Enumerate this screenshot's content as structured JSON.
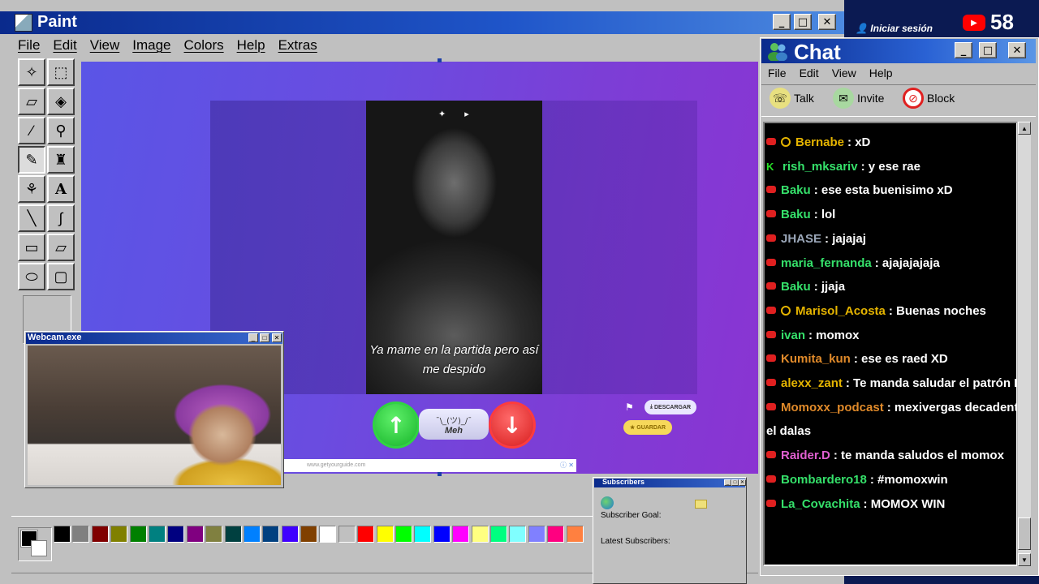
{
  "paint": {
    "title": "Paint",
    "menu": [
      "File",
      "Edit",
      "View",
      "Image",
      "Colors",
      "Help",
      "Extras"
    ],
    "tools": [
      "free-select-icon",
      "rect-select-icon",
      "eraser-icon",
      "fill-icon",
      "picker-icon",
      "magnifier-icon",
      "pencil-icon",
      "brush-icon",
      "airbrush-icon",
      "text-icon",
      "line-icon",
      "curve-icon",
      "rectangle-icon",
      "polygon-icon",
      "ellipse-icon",
      "rounded-rect-icon"
    ],
    "active_tool": "pencil-icon",
    "palette": [
      "#000000",
      "#808080",
      "#800000",
      "#808000",
      "#008000",
      "#008080",
      "#000080",
      "#800080",
      "#808040",
      "#004040",
      "#0080ff",
      "#004080",
      "#4000ff",
      "#804000",
      "#ffffff",
      "#c0c0c0",
      "#ff0000",
      "#ffff00",
      "#00ff00",
      "#00ffff",
      "#0000ff",
      "#ff00ff",
      "#ffff80",
      "#00ff80",
      "#80ffff",
      "#8080ff",
      "#ff0080",
      "#ff8040"
    ]
  },
  "post": {
    "caption_line1": "Ya mame en la partida pero así",
    "caption_line2": "me despido",
    "meh_face": "¯\\_(ツ)_/¯",
    "meh_label": "Meh",
    "descargar_label": "DESCARGAR",
    "guardar_label": "GUARDAR",
    "ad_text": "www.getyourguide.com"
  },
  "topbar": {
    "login_label": "Iniciar sesión",
    "youtube_count": "58"
  },
  "chat": {
    "title": "Chat",
    "menu": [
      "File",
      "Edit",
      "View",
      "Help"
    ],
    "toolbar": [
      {
        "label": "Talk",
        "icon": "talk-icon"
      },
      {
        "label": "Invite",
        "icon": "invite-icon"
      },
      {
        "label": "Block",
        "icon": "block-icon"
      }
    ],
    "messages": [
      {
        "user": "Bernabe",
        "text": ": xD",
        "color": "#e5b400",
        "badge": "yt",
        "mod": true
      },
      {
        "user": "rish_mksariv",
        "text": ": y ese rae",
        "color": "#35e06a",
        "badge": "kick",
        "mod": false
      },
      {
        "user": "Baku",
        "text": ": ese esta buenisimo xD",
        "color": "#35e06a",
        "badge": "yt",
        "mod": false
      },
      {
        "user": "Baku",
        "text": ": lol",
        "color": "#35e06a",
        "badge": "yt",
        "mod": false
      },
      {
        "user": "JHASE",
        "text": ": jajajaj",
        "color": "#9aa6b8",
        "badge": "yt",
        "mod": false
      },
      {
        "user": "maria_fernanda",
        "text": ": ajajajajaja",
        "color": "#35e06a",
        "badge": "yt",
        "mod": false
      },
      {
        "user": "Baku",
        "text": ": jjaja",
        "color": "#35e06a",
        "badge": "yt",
        "mod": false
      },
      {
        "user": "Marisol_Acosta",
        "text": ": Buenas noches",
        "color": "#e5b400",
        "badge": "yt",
        "mod": true
      },
      {
        "user": "ivan",
        "text": ": momox",
        "color": "#35e06a",
        "badge": "yt",
        "mod": false
      },
      {
        "user": "Kumita_kun",
        "text": ": ese es raed XD",
        "color": "#e08a2a",
        "badge": "yt",
        "mod": false
      },
      {
        "user": "alexx_zant",
        "text": ": Te manda saludar el patrón Mo",
        "color": "#e5b400",
        "badge": "yt",
        "mod": false
      },
      {
        "user": "Momoxx_podcast",
        "text": ": mexivergas decadent tu",
        "color": "#e08a2a",
        "badge": "yt",
        "mod": false
      },
      {
        "user": "",
        "text": "el dalas",
        "color": "#ffffff",
        "badge": "none",
        "mod": false
      },
      {
        "user": "Raider.D",
        "text": ": te manda saludos el momox",
        "color": "#e05fd0",
        "badge": "yt",
        "mod": false
      },
      {
        "user": "Bombardero18",
        "text": ": #momoxwin",
        "color": "#35e06a",
        "badge": "yt",
        "mod": false
      },
      {
        "user": "La_Covachita",
        "text": ": MOMOX WIN",
        "color": "#35e06a",
        "badge": "yt",
        "mod": false
      }
    ]
  },
  "webcam": {
    "title": "Webcam.exe"
  },
  "subscribers": {
    "title": "Subscribers",
    "goal_label": "Subscriber Goal:",
    "latest_label": "Latest Subscribers:"
  }
}
